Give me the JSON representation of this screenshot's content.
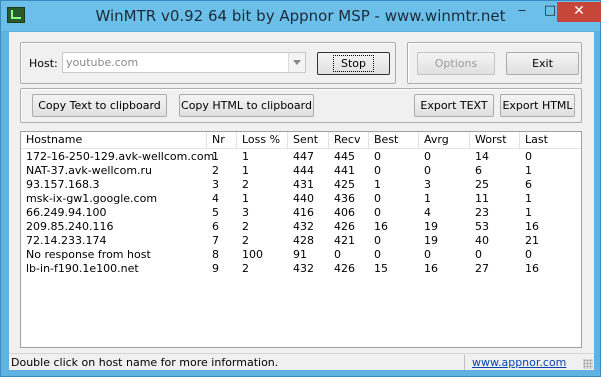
{
  "window": {
    "title": "WinMTR v0.92 64 bit by Appnor MSP - www.winmtr.net",
    "minimize_glyph": "‒",
    "maximize_glyph": "□",
    "close_glyph": "✕"
  },
  "host": {
    "label": "Host:",
    "value": "youtube.com"
  },
  "buttons": {
    "stop": "Stop",
    "options": "Options",
    "exit": "Exit",
    "copy_text": "Copy Text to clipboard",
    "copy_html": "Copy HTML to clipboard",
    "export_text": "Export TEXT",
    "export_html": "Export HTML"
  },
  "table": {
    "columns": [
      "Hostname",
      "Nr",
      "Loss %",
      "Sent",
      "Recv",
      "Best",
      "Avrg",
      "Worst",
      "Last"
    ],
    "rows": [
      [
        "172-16-250-129.avk-wellcom.com",
        "1",
        "1",
        "447",
        "445",
        "0",
        "0",
        "14",
        "0"
      ],
      [
        "NAT-37.avk-wellcom.ru",
        "2",
        "1",
        "444",
        "441",
        "0",
        "0",
        "6",
        "1"
      ],
      [
        "93.157.168.3",
        "3",
        "2",
        "431",
        "425",
        "1",
        "3",
        "25",
        "6"
      ],
      [
        "msk-ix-gw1.google.com",
        "4",
        "1",
        "440",
        "436",
        "0",
        "1",
        "11",
        "1"
      ],
      [
        "66.249.94.100",
        "5",
        "3",
        "416",
        "406",
        "0",
        "4",
        "23",
        "1"
      ],
      [
        "209.85.240.116",
        "6",
        "2",
        "432",
        "426",
        "16",
        "19",
        "53",
        "16"
      ],
      [
        "72.14.233.174",
        "7",
        "2",
        "428",
        "421",
        "0",
        "19",
        "40",
        "21"
      ],
      [
        "No response from host",
        "8",
        "100",
        "91",
        "0",
        "0",
        "0",
        "0",
        "0"
      ],
      [
        "lb-in-f190.1e100.net",
        "9",
        "2",
        "432",
        "426",
        "15",
        "16",
        "27",
        "16"
      ]
    ]
  },
  "status": {
    "text": "Double click on host name for more information.",
    "link": "www.appnor.com"
  },
  "colors": {
    "title_bar": "#6cbfe8",
    "close_button": "#c7463a",
    "link": "#0645ad"
  }
}
